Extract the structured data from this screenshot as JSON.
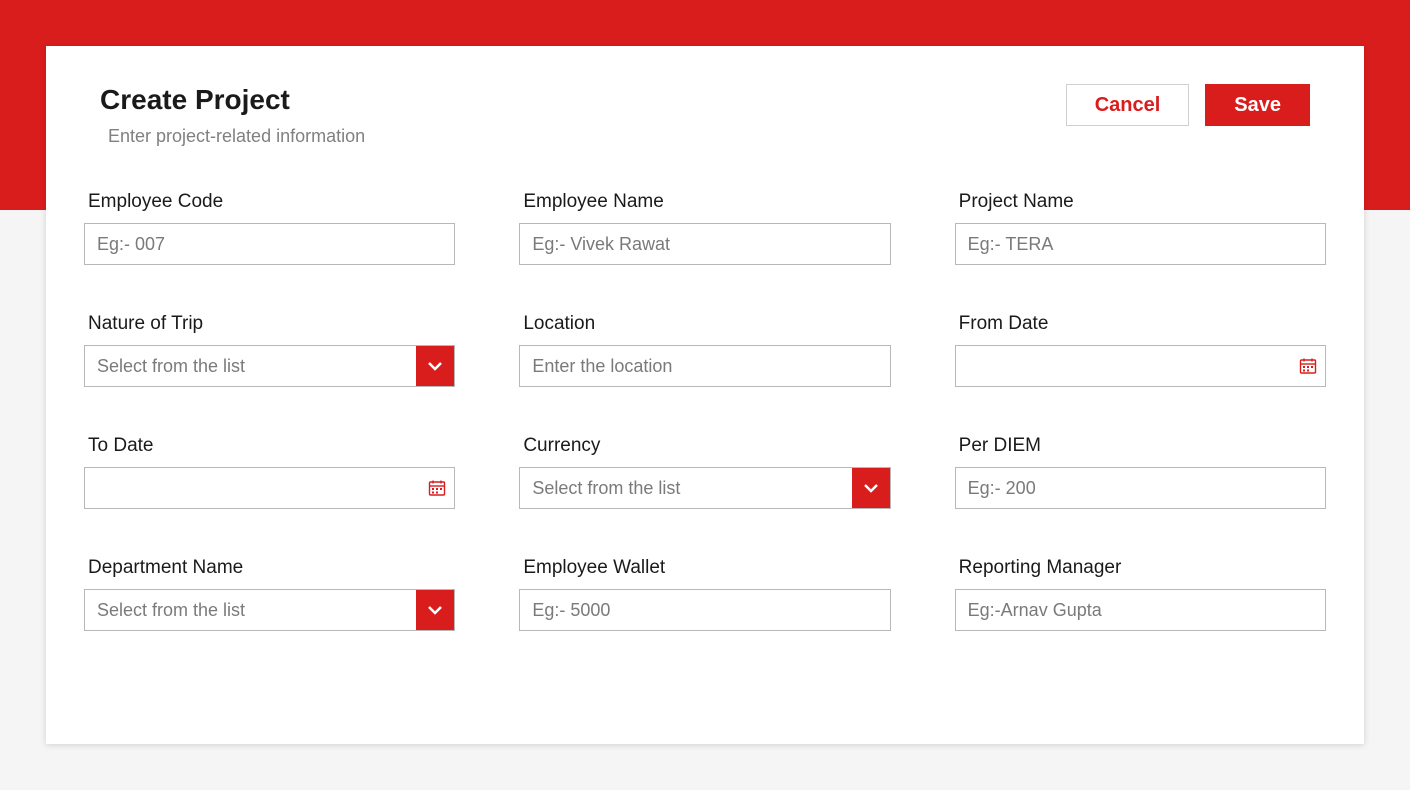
{
  "header": {
    "title": "Create Project",
    "subtitle": "Enter project-related information",
    "cancel_label": "Cancel",
    "save_label": "Save"
  },
  "fields": {
    "employee_code": {
      "label": "Employee Code",
      "placeholder": "Eg:- 007",
      "value": ""
    },
    "employee_name": {
      "label": "Employee Name",
      "placeholder": "Eg:- Vivek Rawat",
      "value": ""
    },
    "project_name": {
      "label": "Project Name",
      "placeholder": "Eg:- TERA",
      "value": ""
    },
    "nature_of_trip": {
      "label": "Nature of Trip",
      "placeholder": "Select from the list",
      "value": ""
    },
    "location": {
      "label": "Location",
      "placeholder": "Enter the location",
      "value": ""
    },
    "from_date": {
      "label": "From Date",
      "placeholder": "",
      "value": ""
    },
    "to_date": {
      "label": "To Date",
      "placeholder": "",
      "value": ""
    },
    "currency": {
      "label": "Currency",
      "placeholder": "Select from the list",
      "value": ""
    },
    "per_diem": {
      "label": "Per DIEM",
      "placeholder": "Eg:- 200",
      "value": ""
    },
    "department_name": {
      "label": "Department Name",
      "placeholder": "Select from the list",
      "value": ""
    },
    "employee_wallet": {
      "label": "Employee Wallet",
      "placeholder": "Eg:- 5000",
      "value": ""
    },
    "reporting_manager": {
      "label": "Reporting Manager",
      "placeholder": "Eg:-Arnav Gupta",
      "value": ""
    }
  },
  "colors": {
    "accent": "#d91d1d"
  }
}
